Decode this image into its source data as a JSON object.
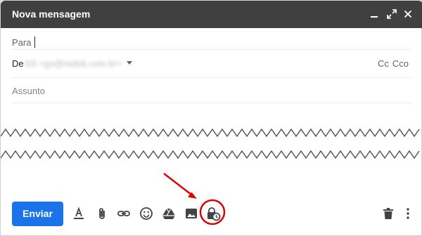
{
  "window": {
    "title": "Nova mensagem",
    "controls": [
      "minimize-icon",
      "fullscreen-icon",
      "close-icon"
    ]
  },
  "compose": {
    "to_label": "Para",
    "from_label": "De",
    "from_value": "SS <gs@netbit.com.br>",
    "cc_label": "Cc",
    "bcc_label": "Cco",
    "subject_placeholder": "Assunto"
  },
  "toolbar": {
    "send_label": "Enviar",
    "icons": [
      "format-text-icon",
      "attachment-icon",
      "link-icon",
      "emoji-icon",
      "drive-icon",
      "photo-icon",
      "confidential-mode-icon",
      "trash-icon",
      "more-options-icon"
    ]
  },
  "colors": {
    "titlebar": "#404040",
    "send": "#1a73e8",
    "annotation": "#e00000"
  }
}
